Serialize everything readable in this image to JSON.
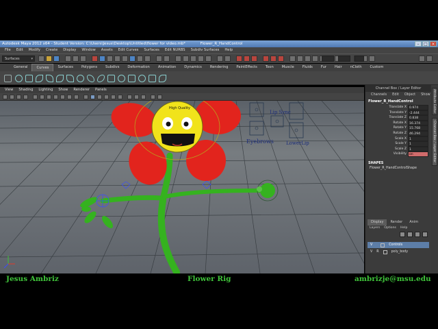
{
  "window": {
    "title": "Autodesk Maya 2012 x64 - Student Version: C:\\Users\\Jesus\\Desktop\\Untitled\\flower for video.mb*",
    "selected_object": "Flower_R_HandControl",
    "controls": [
      "minimize",
      "maximize",
      "close"
    ]
  },
  "menubar": [
    "File",
    "Edit",
    "Modify",
    "Create",
    "Display",
    "Window",
    "Assets",
    "Edit Curves",
    "Surfaces",
    "Edit NURBS",
    "Subdiv Surfaces",
    "Help"
  ],
  "status_line": {
    "menu_set": "Surfaces"
  },
  "shelf": {
    "tabs": [
      "General",
      "Curves",
      "Surfaces",
      "Polygons",
      "Subdivs",
      "Deformation",
      "Animation",
      "Dynamics",
      "Rendering",
      "PaintEffects",
      "Toon",
      "Muscle",
      "Fluids",
      "Fur",
      "Hair",
      "nCloth",
      "Custom"
    ],
    "active_tab": "Curves"
  },
  "panel": {
    "menus": [
      "View",
      "Shading",
      "Lighting",
      "Show",
      "Renderer",
      "Panels"
    ]
  },
  "viewport": {
    "hud_label": "High Quality",
    "facial_controls": [
      "Lip Sync",
      "Eyebrows",
      "LowerLip"
    ],
    "colors": {
      "petal": "#e2241d",
      "stem": "#35b21f",
      "face": "#f1e31b",
      "grid": "#2f3438"
    }
  },
  "channel_box": {
    "header": "Channel Box / Layer Editor",
    "menus": [
      "Channels",
      "Edit",
      "Object",
      "Show"
    ],
    "object": "Flower_R_HandControl",
    "attributes": [
      {
        "name": "Translate X",
        "value": "0.974"
      },
      {
        "name": "Translate Y",
        "value": "-2.444"
      },
      {
        "name": "Translate Z",
        "value": "0.838"
      },
      {
        "name": "Rotate X",
        "value": "16.374"
      },
      {
        "name": "Rotate Y",
        "value": "15.768"
      },
      {
        "name": "Rotate Z",
        "value": "46.294"
      },
      {
        "name": "Scale X",
        "value": "1"
      },
      {
        "name": "Scale Y",
        "value": "1"
      },
      {
        "name": "Scale Z",
        "value": "1"
      },
      {
        "name": "Visibility",
        "value": "on"
      }
    ],
    "shapes_label": "SHAPES",
    "shape_name": "Flower_R_HandControlShape"
  },
  "layer_editor": {
    "tabs": [
      "Display",
      "Render",
      "Anim"
    ],
    "active_tab": "Display",
    "menus": [
      "Layers",
      "Options",
      "Help"
    ],
    "layers": [
      {
        "v": "V",
        "p": "",
        "name": "Controls",
        "selected": true
      },
      {
        "v": "V",
        "p": "R",
        "name": "poly_body",
        "selected": false
      }
    ]
  },
  "side_tabs": [
    "Attribute Editor",
    "Channel Box / Layer Editor"
  ],
  "footer": {
    "left": "Jesus Ambriz",
    "center": "Flower Rig",
    "right": "ambrizje@msu.edu"
  }
}
